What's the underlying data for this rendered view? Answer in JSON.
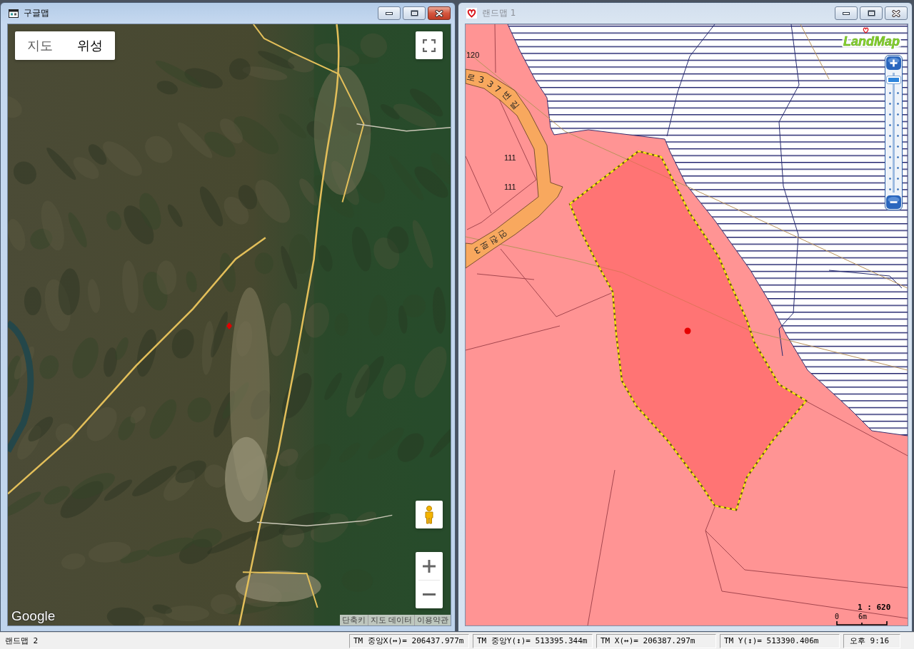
{
  "windows": [
    {
      "kind": "google_map",
      "title": "구글맵",
      "active": true,
      "map_types": [
        {
          "label": "지도",
          "selected": false
        },
        {
          "label": "위성",
          "selected": true
        }
      ],
      "logo": "Google",
      "footer_links": [
        "단축키",
        "지도 데이터",
        "이용약관"
      ]
    },
    {
      "kind": "land_map",
      "title": "랜드맵 1",
      "active": false,
      "logo": "LandMap",
      "zoom_slider": {
        "level": 0.97
      },
      "labels": [
        {
          "kind": "lot",
          "text": "120"
        },
        {
          "kind": "road",
          "text": "로337번길"
        },
        {
          "kind": "lot",
          "text": "111"
        },
        {
          "kind": "lot",
          "text": "111"
        },
        {
          "kind": "road",
          "text": "연천로3"
        }
      ],
      "scale": {
        "ratio": "1 : 620",
        "start": "0",
        "end": "6m"
      }
    }
  ],
  "status_bar": {
    "document": "랜드맵 2",
    "fields": [
      "TM 중앙X(↔)= 206437.977m",
      "TM 중앙Y(↕)= 513395.344m",
      "TM X(↔)= 206387.297m",
      "TM Y(↕)= 513390.406m"
    ],
    "clock": "오후 9:16"
  }
}
